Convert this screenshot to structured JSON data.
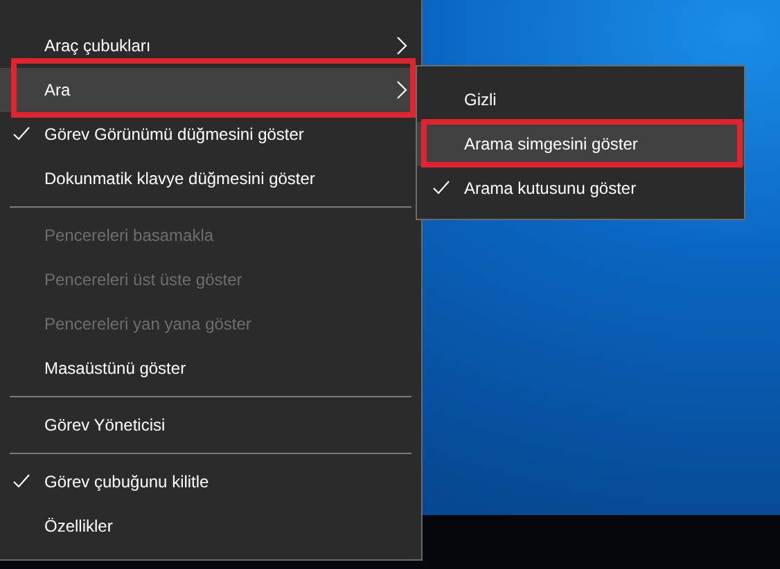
{
  "context_menu": {
    "items": [
      {
        "kind": "item",
        "label": "Araç çubukları",
        "checked": false,
        "disabled": false,
        "has_submenu": true,
        "hovered": false,
        "framed": false
      },
      {
        "kind": "item",
        "label": "Ara",
        "checked": false,
        "disabled": false,
        "has_submenu": true,
        "hovered": true,
        "framed": true
      },
      {
        "kind": "item",
        "label": "Görev Görünümü düğmesini göster",
        "checked": true,
        "disabled": false,
        "has_submenu": false,
        "hovered": false,
        "framed": false
      },
      {
        "kind": "item",
        "label": "Dokunmatik klavye düğmesini göster",
        "checked": false,
        "disabled": false,
        "has_submenu": false,
        "hovered": false,
        "framed": false
      },
      {
        "kind": "separator"
      },
      {
        "kind": "item",
        "label": "Pencereleri basamakla",
        "checked": false,
        "disabled": true,
        "has_submenu": false,
        "hovered": false,
        "framed": false
      },
      {
        "kind": "item",
        "label": "Pencereleri üst üste göster",
        "checked": false,
        "disabled": true,
        "has_submenu": false,
        "hovered": false,
        "framed": false
      },
      {
        "kind": "item",
        "label": "Pencereleri yan yana göster",
        "checked": false,
        "disabled": true,
        "has_submenu": false,
        "hovered": false,
        "framed": false
      },
      {
        "kind": "item",
        "label": "Masaüstünü göster",
        "checked": false,
        "disabled": false,
        "has_submenu": false,
        "hovered": false,
        "framed": false
      },
      {
        "kind": "separator"
      },
      {
        "kind": "item",
        "label": "Görev Yöneticisi",
        "checked": false,
        "disabled": false,
        "has_submenu": false,
        "hovered": false,
        "framed": false
      },
      {
        "kind": "separator"
      },
      {
        "kind": "item",
        "label": "Görev çubuğunu kilitle",
        "checked": true,
        "disabled": false,
        "has_submenu": false,
        "hovered": false,
        "framed": false
      },
      {
        "kind": "item",
        "label": "Özellikler",
        "checked": false,
        "disabled": false,
        "has_submenu": false,
        "hovered": false,
        "framed": false
      }
    ]
  },
  "submenu": {
    "items": [
      {
        "kind": "item",
        "label": "Gizli",
        "checked": false,
        "disabled": false,
        "has_submenu": false,
        "hovered": false,
        "framed": false
      },
      {
        "kind": "item",
        "label": "Arama simgesini göster",
        "checked": false,
        "disabled": false,
        "has_submenu": false,
        "hovered": true,
        "framed": true
      },
      {
        "kind": "item",
        "label": "Arama kutusunu göster",
        "checked": true,
        "disabled": false,
        "has_submenu": false,
        "hovered": false,
        "framed": false
      }
    ]
  }
}
